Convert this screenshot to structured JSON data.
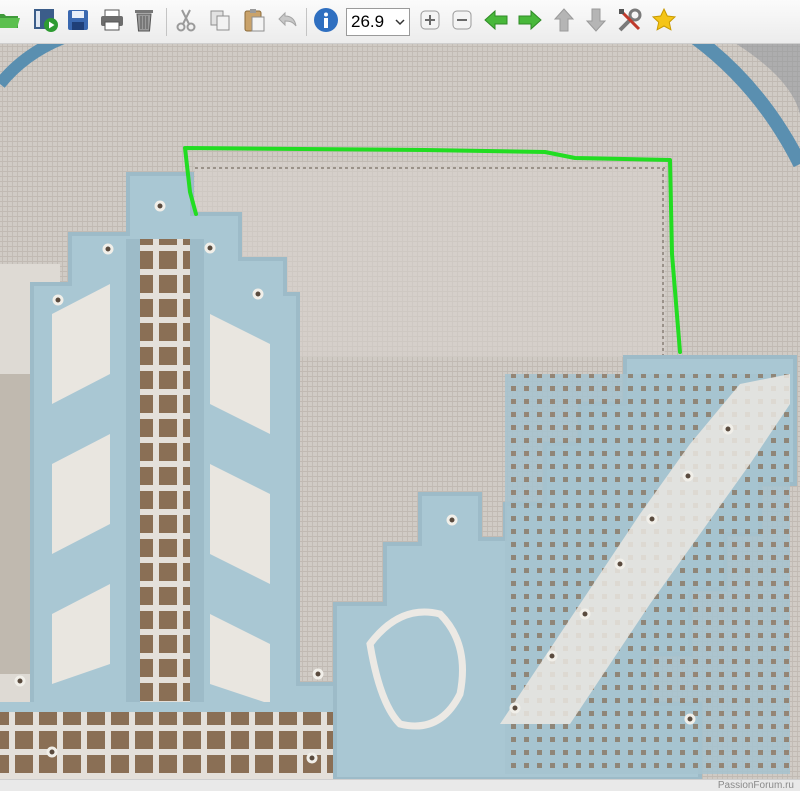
{
  "toolbar": {
    "zoom": {
      "value": "26.9"
    },
    "buttons": [
      {
        "name": "open-folder",
        "icon": "folder-open-icon"
      },
      {
        "name": "slideshow",
        "icon": "slideshow-icon"
      },
      {
        "name": "save",
        "icon": "save-disk-icon"
      },
      {
        "name": "print",
        "icon": "printer-icon"
      },
      {
        "name": "delete",
        "icon": "trash-icon"
      },
      {
        "name": "cut",
        "icon": "scissors-icon"
      },
      {
        "name": "copy",
        "icon": "copy-icon"
      },
      {
        "name": "paste",
        "icon": "paste-clipboard-icon"
      },
      {
        "name": "undo",
        "icon": "undo-arrow-icon"
      },
      {
        "name": "info",
        "icon": "info-icon"
      },
      {
        "name": "zoom-in",
        "icon": "plus-icon"
      },
      {
        "name": "zoom-out",
        "icon": "minus-icon"
      },
      {
        "name": "previous",
        "icon": "arrow-left-icon"
      },
      {
        "name": "next",
        "icon": "arrow-right-icon"
      },
      {
        "name": "move-up",
        "icon": "arrow-up-icon"
      },
      {
        "name": "move-down",
        "icon": "arrow-down-icon"
      },
      {
        "name": "tools",
        "icon": "tools-icon"
      },
      {
        "name": "favorite",
        "icon": "star-icon"
      }
    ]
  },
  "colors": {
    "linen": "#cfc9c2",
    "thread_blue": "#a9c7d3",
    "thread_white": "#e9e6e0",
    "guide_line": "#22dd22",
    "hoop": "#5a8fb0"
  },
  "watermark": {
    "text": "PassionForum.ru"
  }
}
